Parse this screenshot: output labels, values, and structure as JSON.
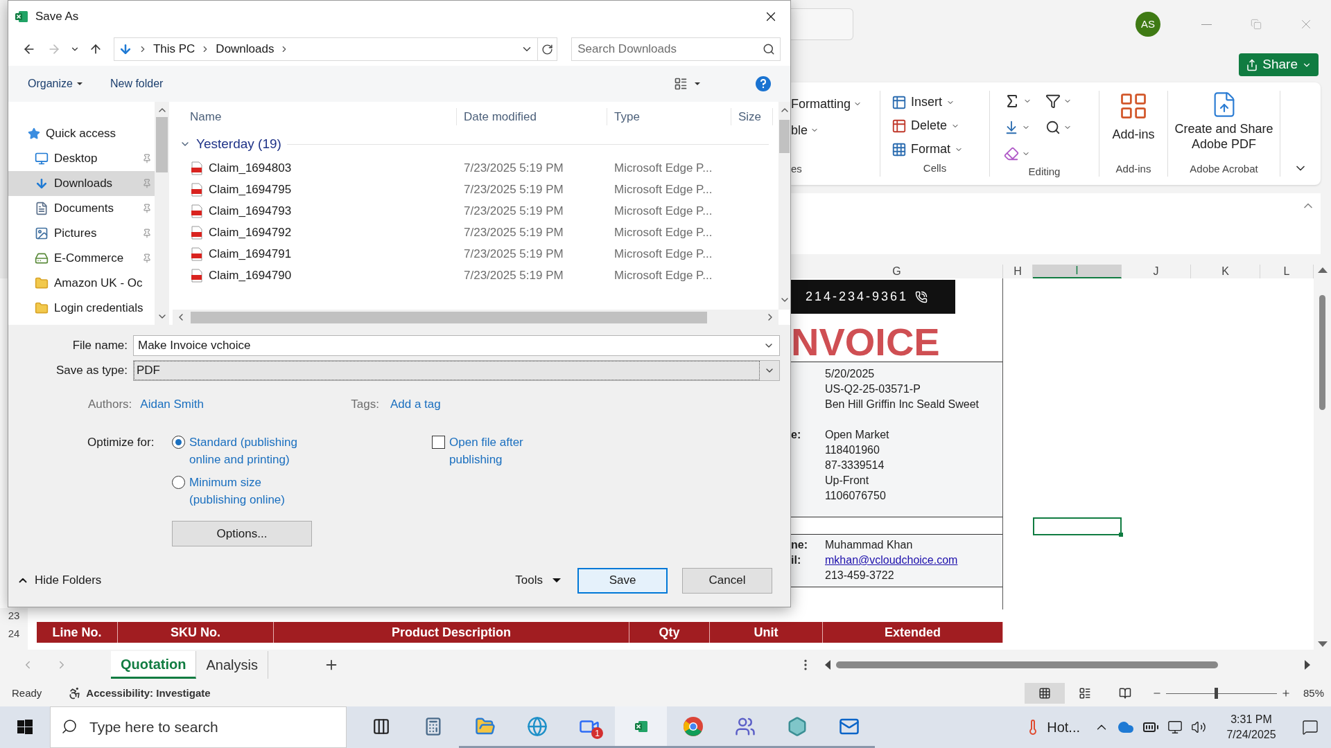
{
  "excel": {
    "title_bar": {
      "avatar": "AS"
    },
    "share_button": "Share",
    "ribbon": {
      "styles_group": {
        "label": "es",
        "items": [
          "Formatting",
          "ble"
        ]
      },
      "cells_group": {
        "label": "Cells",
        "items": [
          {
            "kind": "insert",
            "label": "Insert"
          },
          {
            "kind": "delete",
            "label": "Delete"
          },
          {
            "kind": "format",
            "label": "Format"
          }
        ]
      },
      "editing_group": {
        "label": "Editing",
        "items": [
          {
            "kind": "sum"
          },
          {
            "kind": "sort_filter"
          },
          {
            "kind": "fill"
          },
          {
            "kind": "find"
          },
          {
            "kind": "clear"
          }
        ]
      },
      "addins_group": {
        "label": "Add-ins",
        "button": "Add-ins"
      },
      "acrobat_group": {
        "label": "Adobe Acrobat",
        "button": "Create and Share Adobe PDF"
      }
    },
    "column_headers": [
      {
        "label": "G",
        "selected": false
      },
      {
        "label": "H",
        "selected": false
      },
      {
        "label": "I",
        "selected": true
      },
      {
        "label": "J",
        "selected": false
      },
      {
        "label": "K",
        "selected": false
      },
      {
        "label": "L",
        "selected": false
      }
    ],
    "invoice": {
      "phone": "214-234-9361",
      "title": "NVOICE",
      "detail_blocks": [
        [
          {
            "value": "5/20/2025"
          },
          {
            "value": "US-Q2-25-03571-P"
          },
          {
            "value": "Ben Hill Griffin Inc Seald Sweet"
          }
        ],
        [
          {
            "label": "e:",
            "value": "Open Market"
          },
          {
            "value": "118401960"
          },
          {
            "value": "87-3339514"
          },
          {
            "value": "Up-Front"
          },
          {
            "value": "1106076750"
          }
        ]
      ],
      "contact": [
        {
          "label": "ne:",
          "value": "Muhammad Khan",
          "kind": "text"
        },
        {
          "label": "il:",
          "value": "mkhan@vcloudchoice.com",
          "kind": "link"
        },
        {
          "value": "213-459-3722",
          "kind": "text"
        }
      ]
    },
    "row_numbers": [
      "23",
      "24"
    ],
    "table_header": [
      "Line No.",
      "SKU No.",
      "Product Description",
      "Qty",
      "Unit",
      "Extended"
    ],
    "sheet_tabs": [
      {
        "label": "Quotation",
        "selected": true
      },
      {
        "label": "Analysis",
        "selected": false
      }
    ],
    "status_bar": {
      "ready": "Ready",
      "accessibility": "Accessibility: Investigate",
      "views": [
        {
          "kind": "normal",
          "selected": true
        },
        {
          "kind": "page_layout",
          "selected": false
        },
        {
          "kind": "page_break",
          "selected": false
        }
      ],
      "zoom": {
        "level": 0.44,
        "reading": "85%"
      }
    }
  },
  "dialog": {
    "title": "Save As",
    "nav": {
      "forward_disabled": true
    },
    "address": [
      "This PC",
      "Downloads"
    ],
    "search": {
      "placeholder": "Search Downloads"
    },
    "toolbar": {
      "organize": "Organize",
      "new_folder": "New folder"
    },
    "nav_pane": [
      {
        "label": "Quick access",
        "kind": "star",
        "pinned": false,
        "selected": false
      },
      {
        "label": "Desktop",
        "kind": "desktop",
        "pinned": true,
        "selected": false
      },
      {
        "label": "Downloads",
        "kind": "download",
        "pinned": true,
        "selected": true
      },
      {
        "label": "Documents",
        "kind": "documents",
        "pinned": true,
        "selected": false
      },
      {
        "label": "Pictures",
        "kind": "pictures",
        "pinned": true,
        "selected": false
      },
      {
        "label": "E-Commerce",
        "kind": "drive",
        "pinned": true,
        "selected": false
      },
      {
        "label": "Amazon UK - Oc",
        "kind": "folder",
        "pinned": false,
        "selected": false
      },
      {
        "label": "Login credentials",
        "kind": "folder",
        "pinned": false,
        "selected": false
      }
    ],
    "columns": [
      "Name",
      "Date modified",
      "Type",
      "Size"
    ],
    "group": {
      "label": "Yesterday (19)",
      "expanded": true
    },
    "files": [
      {
        "name": "Claim_1694803",
        "date": "7/23/2025 5:19 PM",
        "type": "Microsoft Edge P..."
      },
      {
        "name": "Claim_1694795",
        "date": "7/23/2025 5:19 PM",
        "type": "Microsoft Edge P..."
      },
      {
        "name": "Claim_1694793",
        "date": "7/23/2025 5:19 PM",
        "type": "Microsoft Edge P..."
      },
      {
        "name": "Claim_1694792",
        "date": "7/23/2025 5:19 PM",
        "type": "Microsoft Edge P..."
      },
      {
        "name": "Claim_1694791",
        "date": "7/23/2025 5:19 PM",
        "type": "Microsoft Edge P..."
      },
      {
        "name": "Claim_1694790",
        "date": "7/23/2025 5:19 PM",
        "type": "Microsoft Edge P..."
      }
    ],
    "file_name": {
      "label": "File name:",
      "value": "Make Invoice vchoice"
    },
    "save_as_type": {
      "label": "Save as type:",
      "value": "PDF"
    },
    "authors": {
      "label": "Authors:",
      "value": "Aidan Smith"
    },
    "tags": {
      "label": "Tags:",
      "value": "Add a tag"
    },
    "optimize": {
      "label": "Optimize for:",
      "options": [
        {
          "label": "Standard (publishing online and printing)",
          "selected": true
        },
        {
          "label": "Minimum size (publishing online)",
          "selected": false
        }
      ]
    },
    "open_after": {
      "label": "Open file after publishing",
      "checked": false
    },
    "options_button": "Options...",
    "hide_folders": "Hide Folders",
    "tools": "Tools",
    "save": "Save",
    "cancel": "Cancel"
  },
  "taskbar": {
    "search_placeholder": "Type here to search",
    "apps": [
      {
        "kind": "task_view",
        "running": false,
        "selected": false
      },
      {
        "kind": "calculator",
        "running": false,
        "selected": false
      },
      {
        "kind": "files",
        "running": true,
        "selected": false
      },
      {
        "kind": "edge",
        "running": true,
        "selected": false
      },
      {
        "kind": "zoom",
        "running": true,
        "selected": false,
        "badge": "1"
      },
      {
        "kind": "excel",
        "running": true,
        "selected": true
      },
      {
        "kind": "chrome",
        "running": true,
        "selected": false
      },
      {
        "kind": "teams",
        "running": true,
        "selected": false
      },
      {
        "kind": "diamond",
        "running": true,
        "selected": false
      },
      {
        "kind": "outlook",
        "running": true,
        "selected": false
      }
    ],
    "weather": "Hot...",
    "time": "3:31 PM",
    "date": "7/24/2025"
  }
}
